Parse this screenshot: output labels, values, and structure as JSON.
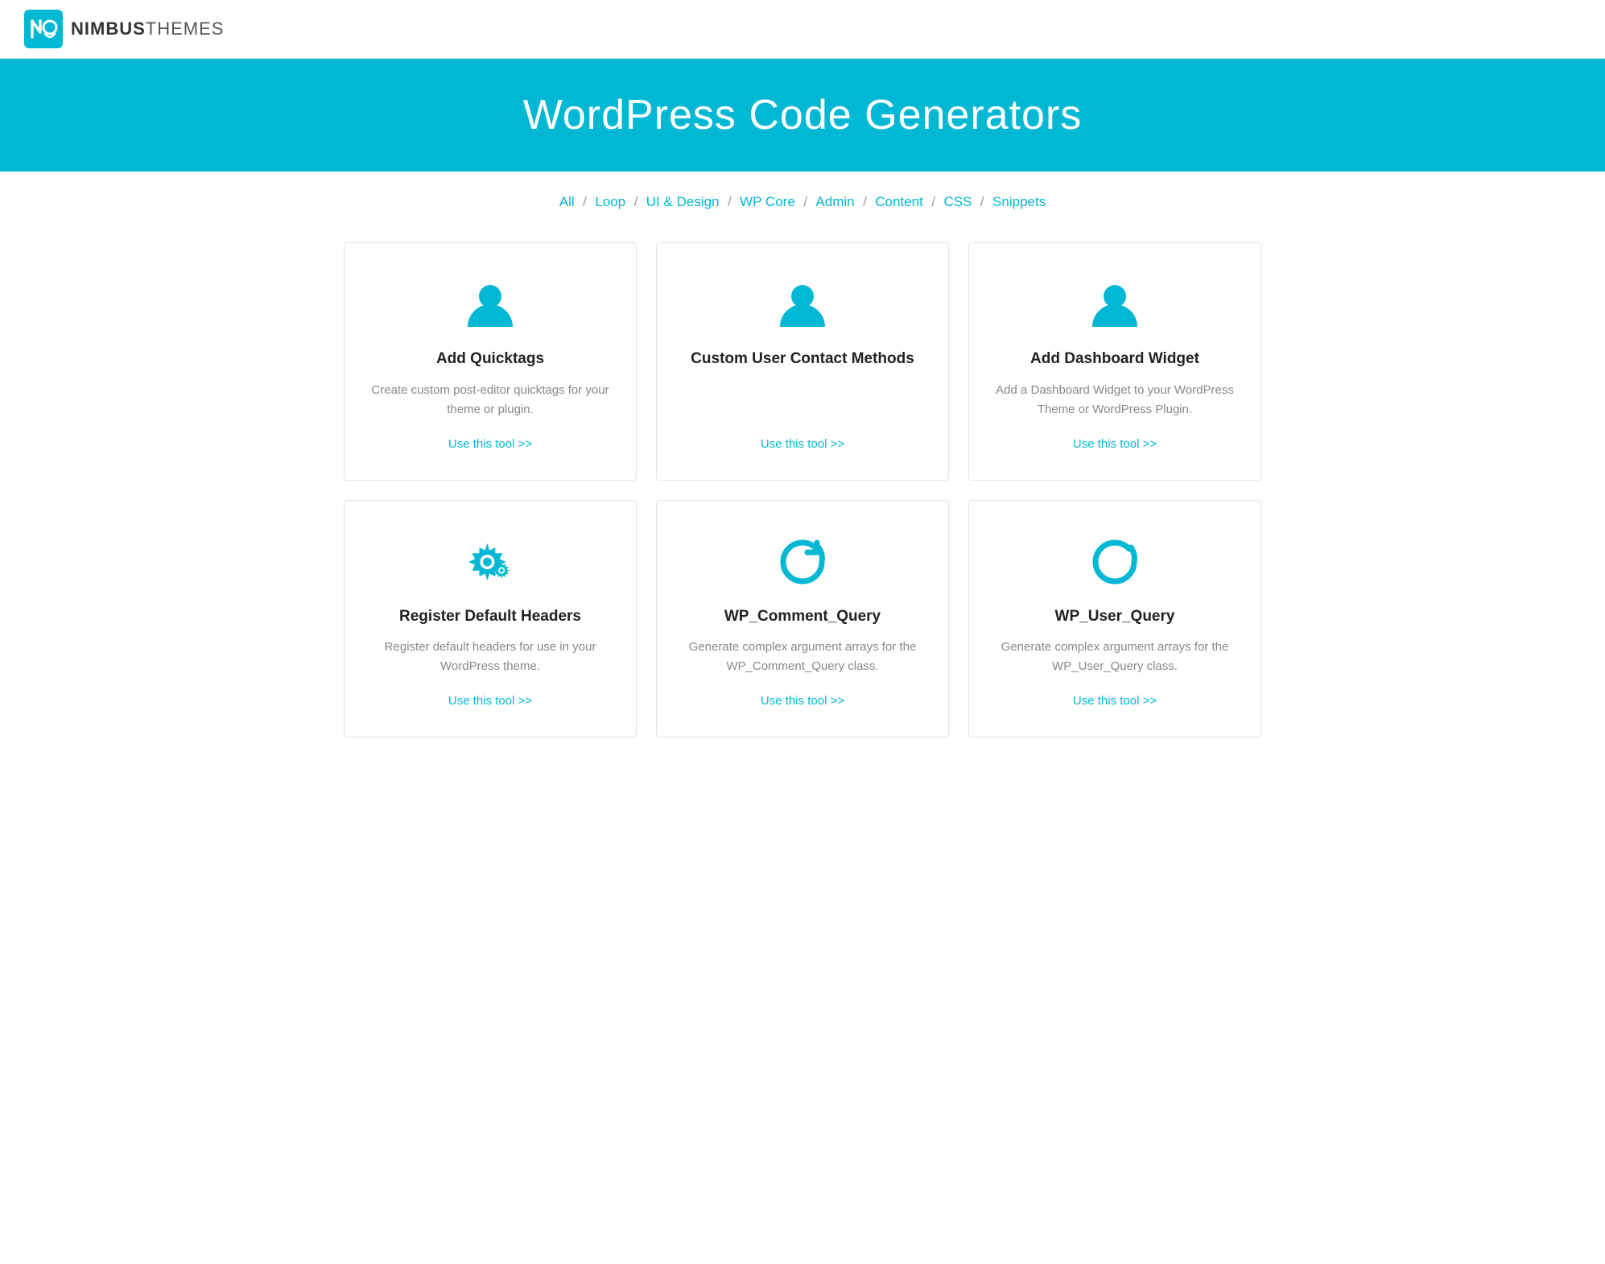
{
  "brand": {
    "logo_text_bold": "NIMBUS",
    "logo_text_light": "THEMES"
  },
  "hero": {
    "title": "WordPress Code Generators"
  },
  "nav": {
    "items": [
      {
        "label": "All",
        "active": true
      },
      {
        "label": "Loop"
      },
      {
        "label": "UI & Design"
      },
      {
        "label": "WP Core"
      },
      {
        "label": "Admin"
      },
      {
        "label": "Content"
      },
      {
        "label": "CSS"
      },
      {
        "label": "Snippets"
      }
    ]
  },
  "cards": [
    {
      "icon": "user",
      "title": "Add Quicktags",
      "description": "Create custom post-editor quicktags for your theme or plugin.",
      "link_label": "Use this tool >>"
    },
    {
      "icon": "user",
      "title": "Custom User Contact Methods",
      "description": "",
      "link_label": "Use this tool >>"
    },
    {
      "icon": "user",
      "title": "Add Dashboard Widget",
      "description": "Add a Dashboard Widget to your WordPress Theme or WordPress Plugin.",
      "link_label": "Use this tool >>"
    },
    {
      "icon": "gears",
      "title": "Register Default Headers",
      "description": "Register default headers for use in your WordPress theme.",
      "link_label": "Use this tool >>"
    },
    {
      "icon": "refresh",
      "title": "WP_Comment_Query",
      "description": "Generate complex argument arrays for the WP_Comment_Query class.",
      "link_label": "Use this tool >>"
    },
    {
      "icon": "refresh",
      "title": "WP_User_Query",
      "description": "Generate complex argument arrays for the WP_User_Query class.",
      "link_label": "Use this tool >>"
    }
  ]
}
